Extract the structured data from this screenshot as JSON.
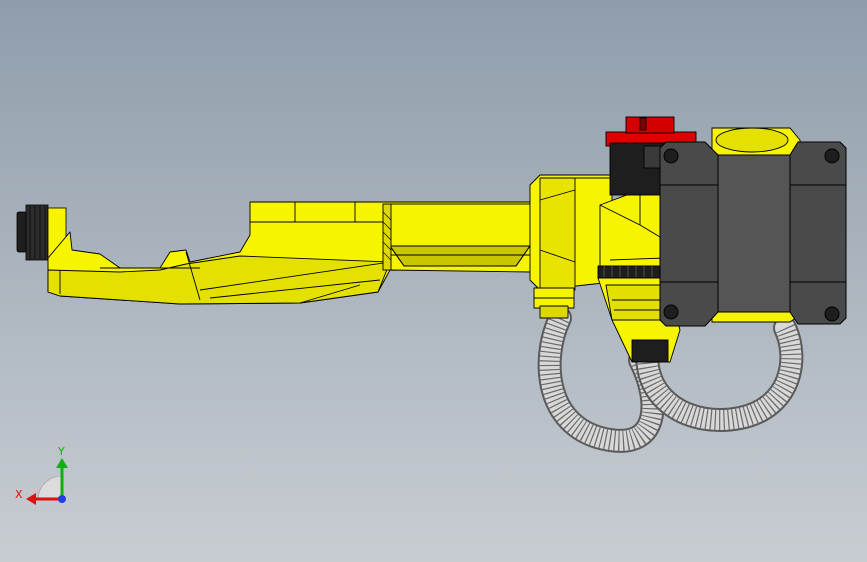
{
  "viewport": {
    "background_top": "#8f9dab",
    "background_bottom": "#c8cdd2"
  },
  "model": {
    "body_color": "#f7f400",
    "body_shade": "#c9c600",
    "motor_color": "#4a4a4a",
    "motor_dark": "#1e1e1e",
    "brake_color": "#e00000",
    "cable_color": "#d8d8d8"
  },
  "triad": {
    "x_label": "X",
    "y_label": "Y",
    "x_color": "#e01010",
    "y_color": "#10b010",
    "z_color": "#2040e0"
  }
}
